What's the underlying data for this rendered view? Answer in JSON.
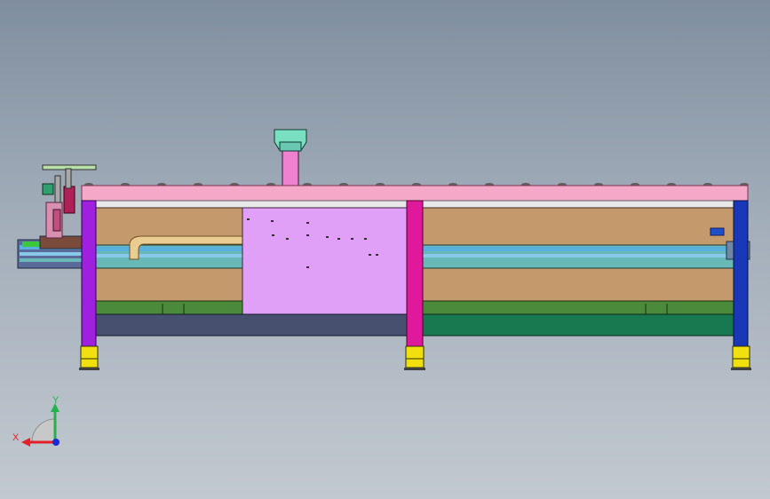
{
  "viewport": {
    "background_top": "#7f8e9f",
    "background_bottom": "#c2c9d0"
  },
  "triad": {
    "x_label": "X",
    "y_label": "Y",
    "x_color": "#e0202a",
    "y_color": "#22b24c",
    "z_color": "#1a2ad8"
  },
  "model": {
    "colors": {
      "top_rail": "#f5a8c8",
      "top_rail_edge": "#b0607c",
      "leg_left": "#a020e0",
      "leg_mid": "#e0189c",
      "leg_right": "#1838b8",
      "foot": "#f0e010",
      "wood_panel": "#c49a6c",
      "center_panel": "#e0a0f8",
      "conveyor_blue": "#58b0e0",
      "conveyor_teal": "#68b8b8",
      "green_base": "#4a8a3a",
      "dark_green_base": "#187850",
      "navy_base": "#485070",
      "top_pink_post": "#f080d0",
      "top_cap": "#78e0c0",
      "hook_tan": "#e8cc90"
    }
  }
}
